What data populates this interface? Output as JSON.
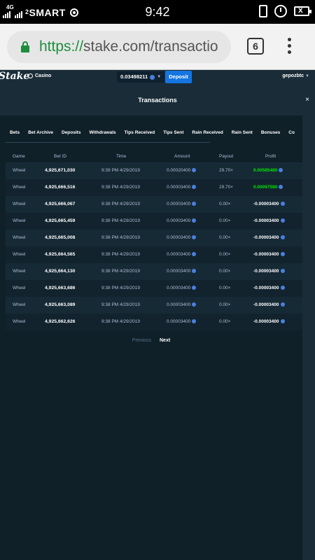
{
  "status_bar": {
    "network": "4G",
    "carrier": "SMART",
    "carrier_sub": "2",
    "time": "9:42"
  },
  "browser": {
    "url_scheme": "https://",
    "url_rest": "stake.com/transactio",
    "tab_count": "6"
  },
  "app": {
    "logo": "Stake",
    "casino_label": "Casino",
    "balance": "0.03498211",
    "deposit_label": "Deposit",
    "username": "gepozbtc"
  },
  "modal": {
    "title": "Transactions",
    "close": "×"
  },
  "tabs": [
    "Bets",
    "Bet Archive",
    "Deposits",
    "Withdrawals",
    "Tips Received",
    "Tips Sent",
    "Rain Received",
    "Rain Sent",
    "Bonuses",
    "Co"
  ],
  "table": {
    "headers": [
      "Game",
      "Bet ID",
      "Time",
      "Amount",
      "Payout",
      "Profit"
    ],
    "rows": [
      {
        "game": "Wheel",
        "bet_id": "4,925,671,030",
        "time": "9:39 PM 4/29/2019",
        "amount": "0.00020400",
        "payout": "29.70×",
        "profit": "0.00585480",
        "positive": true
      },
      {
        "game": "Wheel",
        "bet_id": "4,925,666,516",
        "time": "9:38 PM 4/29/2019",
        "amount": "0.00003400",
        "payout": "29.70×",
        "profit": "0.00097580",
        "positive": true
      },
      {
        "game": "Wheel",
        "bet_id": "4,925,666,067",
        "time": "9:38 PM 4/29/2019",
        "amount": "0.00003400",
        "payout": "0.00×",
        "profit": "-0.00003400",
        "positive": false
      },
      {
        "game": "Wheel",
        "bet_id": "4,925,665,459",
        "time": "9:38 PM 4/29/2019",
        "amount": "0.00003400",
        "payout": "0.00×",
        "profit": "-0.00003400",
        "positive": false
      },
      {
        "game": "Wheel",
        "bet_id": "4,925,665,008",
        "time": "9:38 PM 4/29/2019",
        "amount": "0.00003400",
        "payout": "0.00×",
        "profit": "-0.00003400",
        "positive": false
      },
      {
        "game": "Wheel",
        "bet_id": "4,925,664,565",
        "time": "9:38 PM 4/29/2019",
        "amount": "0.00003400",
        "payout": "0.00×",
        "profit": "-0.00003400",
        "positive": false
      },
      {
        "game": "Wheel",
        "bet_id": "4,925,664,130",
        "time": "9:38 PM 4/29/2019",
        "amount": "0.00003400",
        "payout": "0.00×",
        "profit": "-0.00003400",
        "positive": false
      },
      {
        "game": "Wheel",
        "bet_id": "4,925,663,686",
        "time": "9:38 PM 4/29/2019",
        "amount": "0.00003400",
        "payout": "0.00×",
        "profit": "-0.00003400",
        "positive": false
      },
      {
        "game": "Wheel",
        "bet_id": "4,925,663,089",
        "time": "9:38 PM 4/29/2019",
        "amount": "0.00003400",
        "payout": "0.00×",
        "profit": "-0.00003400",
        "positive": false
      },
      {
        "game": "Wheel",
        "bet_id": "4,925,662,626",
        "time": "9:38 PM 4/29/2019",
        "amount": "0.00003400",
        "payout": "0.00×",
        "profit": "-0.00003400",
        "positive": false
      }
    ]
  },
  "pager": {
    "previous": "Previous",
    "next": "Next"
  },
  "colors": {
    "accent": "#1475e1",
    "positive": "#00e701",
    "background": "#0f2029",
    "header": "#1a2c38"
  }
}
